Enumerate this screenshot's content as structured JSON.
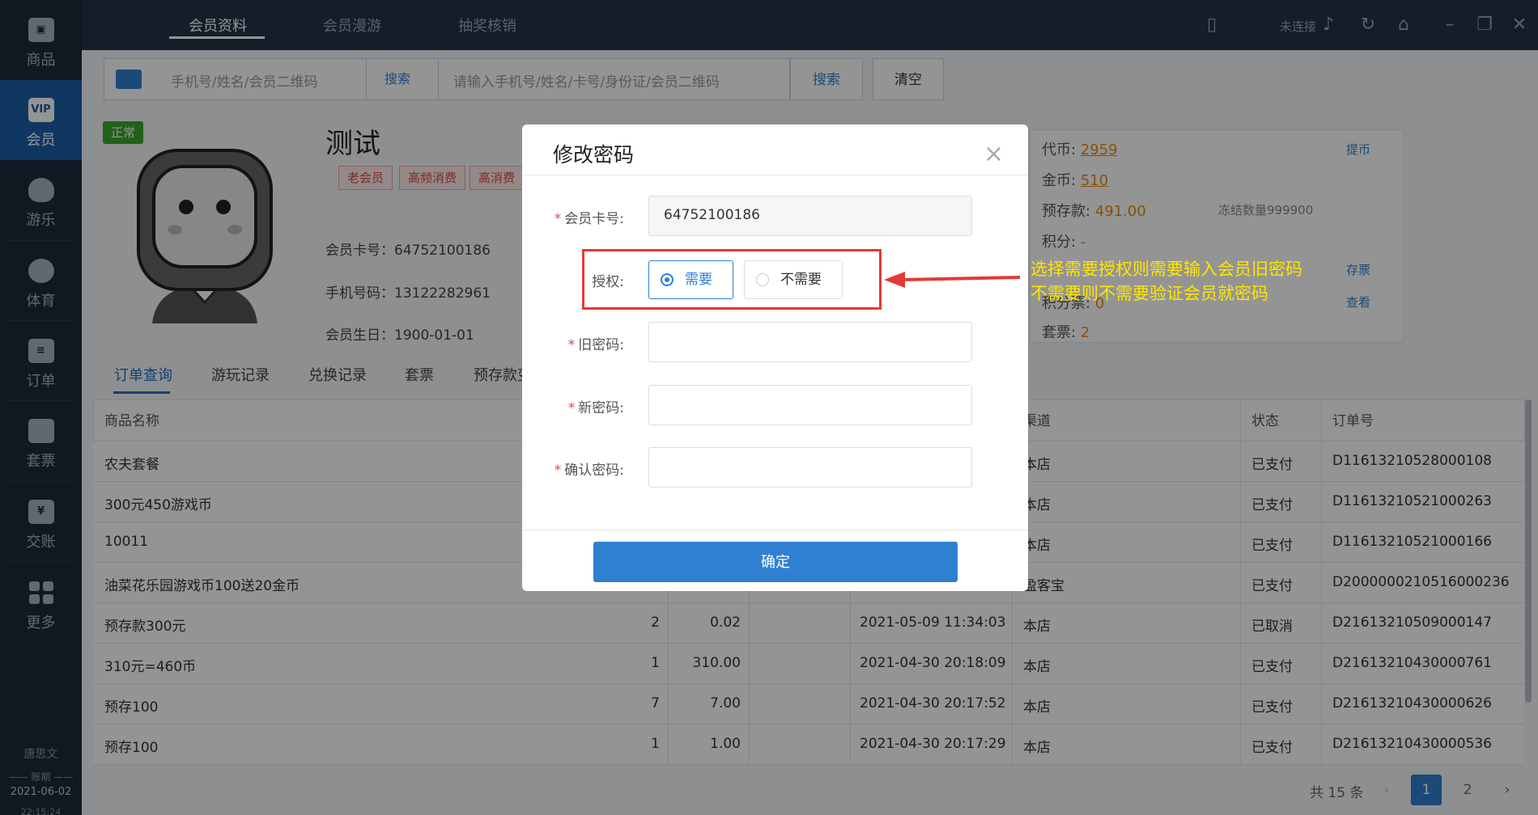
{
  "sidebar": {
    "items": [
      {
        "icon": "bag-icon",
        "label": "商品"
      },
      {
        "icon": "vip-icon",
        "label": "会员",
        "badge": "VIP"
      },
      {
        "icon": "balloon-icon",
        "label": "游乐"
      },
      {
        "icon": "ball-icon",
        "label": "体育"
      },
      {
        "icon": "order-icon",
        "label": "订单"
      },
      {
        "icon": "ticket-icon",
        "label": "套票"
      },
      {
        "icon": "cash-icon",
        "label": "交账",
        "badge": "¥"
      },
      {
        "icon": "grid-icon",
        "label": "更多"
      }
    ],
    "user": "唐思文",
    "account_label": "账期",
    "date": "2021-06-02",
    "time": "22:15:24"
  },
  "topbar": {
    "tabs": [
      "会员资料",
      "会员漫游",
      "抽奖核销"
    ],
    "status": "未连接"
  },
  "search": {
    "placeholder1": "手机号/姓名/会员二维码",
    "button1": "搜索",
    "placeholder2": "请输入手机号/姓名/卡号/身份证/会员二维码",
    "button2": "搜索",
    "clear": "清空"
  },
  "member": {
    "status": "正常",
    "name": "测试",
    "tags": [
      "老会员",
      "高频消费",
      "高消费"
    ],
    "card_label": "会员卡号：",
    "card_no": "64752100186",
    "phone_label": "手机号码：",
    "phone": "13122282961",
    "birthday_label": "会员生日：",
    "birthday": "1900-01-01"
  },
  "assets": {
    "coins_label": "代币:",
    "coins": "2959",
    "coins_action": "提币",
    "gold_label": "金币:",
    "gold": "510",
    "deposit_label": "预存款:",
    "deposit": "491.00",
    "frozen": "冻结数量999900",
    "points_label": "积分:",
    "points": "-",
    "store_action": "存票",
    "row5_label": "积分票:",
    "row5_val": "0",
    "view_action": "查看",
    "tickets_label": "套票:",
    "tickets": "2"
  },
  "tabs": [
    "订单查询",
    "游玩记录",
    "兑换记录",
    "套票",
    "预存款变动"
  ],
  "table": {
    "headers": [
      "商品名称",
      "",
      "",
      "",
      "渠道",
      "状态",
      "订单号"
    ],
    "rows": [
      {
        "name": "农夫套餐",
        "qty": "",
        "amount": "",
        "time": "",
        "channel": "本店",
        "status": "已支付",
        "order": "D11613210528000108"
      },
      {
        "name": "300元450游戏币",
        "qty": "",
        "amount": "",
        "time": "",
        "channel": "本店",
        "status": "已支付",
        "order": "D11613210521000263"
      },
      {
        "name": "10011",
        "qty": "",
        "amount": "",
        "time": "",
        "channel": "本店",
        "status": "已支付",
        "order": "D11613210521000166"
      },
      {
        "name": "油菜花乐园游戏币100送20金币",
        "qty": "",
        "amount": "",
        "time": "",
        "channel": "盈客宝",
        "status": "已支付",
        "order": "D2000000210516000236"
      },
      {
        "name": "预存款300元",
        "qty": "2",
        "amount": "0.02",
        "time": "2021-05-09 11:34:03",
        "channel": "本店",
        "status": "已取消",
        "order": "D21613210509000147"
      },
      {
        "name": "310元=460币",
        "qty": "1",
        "amount": "310.00",
        "time": "2021-04-30 20:18:09",
        "channel": "本店",
        "status": "已支付",
        "order": "D21613210430000761"
      },
      {
        "name": "预存100",
        "qty": "7",
        "amount": "7.00",
        "time": "2021-04-30 20:17:52",
        "channel": "本店",
        "status": "已支付",
        "order": "D21613210430000626"
      },
      {
        "name": "预存100",
        "qty": "1",
        "amount": "1.00",
        "time": "2021-04-30 20:17:29",
        "channel": "本店",
        "status": "已支付",
        "order": "D21613210430000536"
      }
    ]
  },
  "pager": {
    "total": "共 15 条",
    "pages": [
      "1",
      "2"
    ],
    "current": "1"
  },
  "modal": {
    "title": "修改密码",
    "card_label": "会员卡号:",
    "card_value": "64752100186",
    "auth_label": "授权:",
    "auth_options": [
      "需要",
      "不需要"
    ],
    "auth_selected": "需要",
    "old_pwd_label": "旧密码:",
    "new_pwd_label": "新密码:",
    "confirm_pwd_label": "确认密码:",
    "ok": "确定",
    "required_mark": "*"
  },
  "annotation": {
    "line1": "选择需要授权则需要输入会员旧密码",
    "line2": "不需要则不需要验证会员就密码",
    "color": "#ffe600"
  },
  "colors": {
    "primary": "#2f80d1",
    "sidebar": "#1d2a3a",
    "accent_orange": "#e98a10",
    "red": "#e53935"
  }
}
